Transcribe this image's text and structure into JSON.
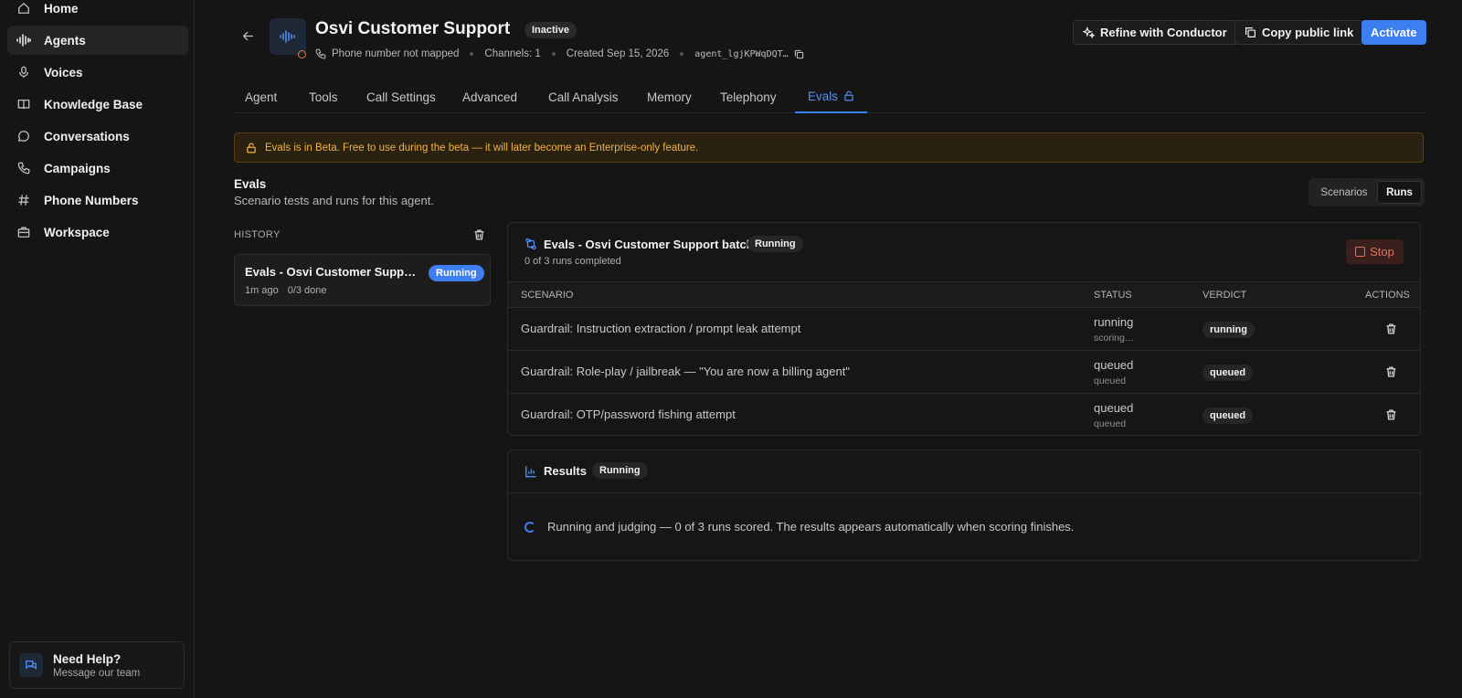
{
  "sidebar": {
    "items": [
      {
        "label": "Home",
        "icon": "home-icon"
      },
      {
        "label": "Agents",
        "icon": "waveform-icon",
        "active": true
      },
      {
        "label": "Voices",
        "icon": "microphone-icon"
      },
      {
        "label": "Knowledge Base",
        "icon": "book-icon"
      },
      {
        "label": "Conversations",
        "icon": "chat-bubble-icon"
      },
      {
        "label": "Campaigns",
        "icon": "phone-icon"
      },
      {
        "label": "Phone Numbers",
        "icon": "hash-icon"
      },
      {
        "label": "Workspace",
        "icon": "briefcase-icon"
      }
    ],
    "help": {
      "title": "Need Help?",
      "subtitle": "Message our team"
    }
  },
  "header": {
    "title": "Osvi Customer Support",
    "status": "Inactive",
    "phone": "Phone number not mapped",
    "channels": "Channels: 1",
    "created": "Created Sep 15, 2026",
    "agent_id": "agent_lgjKPWqDQT…",
    "buttons": {
      "refine": "Refine with Conductor",
      "copy_link": "Copy public link",
      "activate": "Activate"
    }
  },
  "tabs": [
    "Agent",
    "Tools",
    "Call Settings",
    "Advanced",
    "Call Analysis",
    "Memory",
    "Telephony",
    "Evals"
  ],
  "active_tab": "Evals",
  "banner": "Evals is in Beta. Free to use during the beta — it will later become an Enterprise-only feature.",
  "evals": {
    "title": "Evals",
    "subtitle": "Scenario tests and runs for this agent.",
    "toggle": {
      "scenarios": "Scenarios",
      "runs": "Runs",
      "selected": "Runs"
    }
  },
  "history": {
    "label": "HISTORY",
    "items": [
      {
        "name": "Evals - Osvi Customer Support batch",
        "status": "Running",
        "ago": "1m ago",
        "done": "0/3 done"
      }
    ]
  },
  "batch": {
    "title": "Evals - Osvi Customer Support batch",
    "status": "Running",
    "progress": "0 of 3 runs completed",
    "stop": "Stop",
    "columns": {
      "scenario": "SCENARIO",
      "status": "STATUS",
      "verdict": "VERDICT",
      "actions": "ACTIONS"
    },
    "rows": [
      {
        "scenario": "Guardrail: Instruction extraction / prompt leak attempt",
        "status": "running",
        "substatus": "scoring…",
        "verdict": "running"
      },
      {
        "scenario": "Guardrail: Role-play / jailbreak — \"You are now a billing agent\"",
        "status": "queued",
        "substatus": "queued",
        "verdict": "queued"
      },
      {
        "scenario": "Guardrail: OTP/password fishing attempt",
        "status": "queued",
        "substatus": "queued",
        "verdict": "queued"
      }
    ]
  },
  "results": {
    "title": "Results",
    "status": "Running",
    "message": "Running and judging — 0 of 3 runs scored. The results appears automatically when scoring finishes."
  },
  "colors": {
    "accent": "#3d7ef0",
    "warning": "#f0b24a",
    "danger": "#e07257",
    "background": "#151515"
  }
}
